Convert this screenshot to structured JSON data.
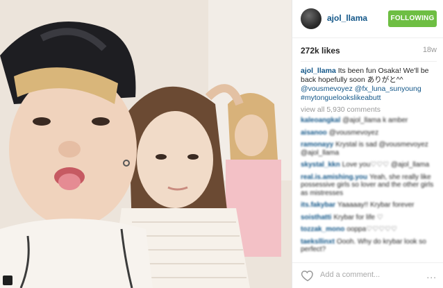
{
  "header": {
    "username": "ajol_llama",
    "follow_label": "FOLLOWING"
  },
  "stats": {
    "likes": "272k likes",
    "age": "18w"
  },
  "caption": {
    "user": "ajol_llama",
    "text": "Its been fun Osaka! We'll be back hopefully soon ありがと^^",
    "mention1": "@vousmevoyez",
    "mention2": "@fx_luna_sunyoung",
    "hashtag": "#mytonguelookslikeabutt"
  },
  "view_all": "view all 5,930 comments",
  "comments": [
    {
      "user": "kaleoangkal",
      "text": "@ajol_llama k amber"
    },
    {
      "user": "aisanoo",
      "text": "@vousmevoyez"
    },
    {
      "user": "ramonayy",
      "text": "Krystal is sad @vousmevoyez @ajol_llama"
    },
    {
      "user": "skystal_kkn",
      "text": "Love you♡♡♡ @ajol_llama"
    },
    {
      "user": "real.is.amishing.you",
      "text": "Yeah, she really like possessive girls so lover and the other girls as mistresses"
    },
    {
      "user": "its.fakybar",
      "text": "Yaaaaay!! Krybar forever"
    },
    {
      "user": "soisthatti",
      "text": "Krybar for life ♡"
    },
    {
      "user": "tozzak_mono",
      "text": "ooppa♡♡♡♡♡"
    },
    {
      "user": "taeksllinxt",
      "text": "Oooh. Why do krybar look so perfect?"
    }
  ],
  "footer": {
    "add_comment_placeholder": "Add a comment...",
    "more_label": "..."
  },
  "icons": {
    "heart": "heart-icon",
    "more": "more-options-icon"
  },
  "colors": {
    "accent": "#6ebe43",
    "link": "#125688",
    "muted": "#999999"
  }
}
